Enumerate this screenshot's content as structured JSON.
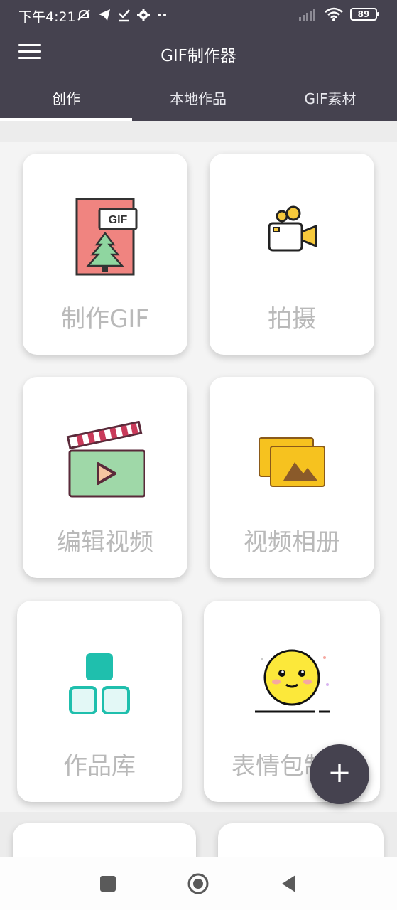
{
  "status_bar": {
    "time": "下午4:21",
    "battery": "89"
  },
  "app_bar": {
    "title": "GIF制作器"
  },
  "tabs": [
    {
      "label": "创作"
    },
    {
      "label": "本地作品"
    },
    {
      "label": "GIF素材"
    }
  ],
  "cards": [
    {
      "label": "制作GIF",
      "icon": "gif-file-icon"
    },
    {
      "label": "拍摄",
      "icon": "video-camera-icon"
    },
    {
      "label": "编辑视频",
      "icon": "clapperboard-icon"
    },
    {
      "label": "视频相册",
      "icon": "photo-album-icon"
    },
    {
      "label": "作品库",
      "icon": "blocks-icon"
    },
    {
      "label": "表情包制作",
      "icon": "smiley-icon"
    }
  ],
  "fab": {
    "label": "+"
  },
  "colors": {
    "header": "#45424f",
    "card_label": "#b9b9b9",
    "background": "#ececec"
  }
}
